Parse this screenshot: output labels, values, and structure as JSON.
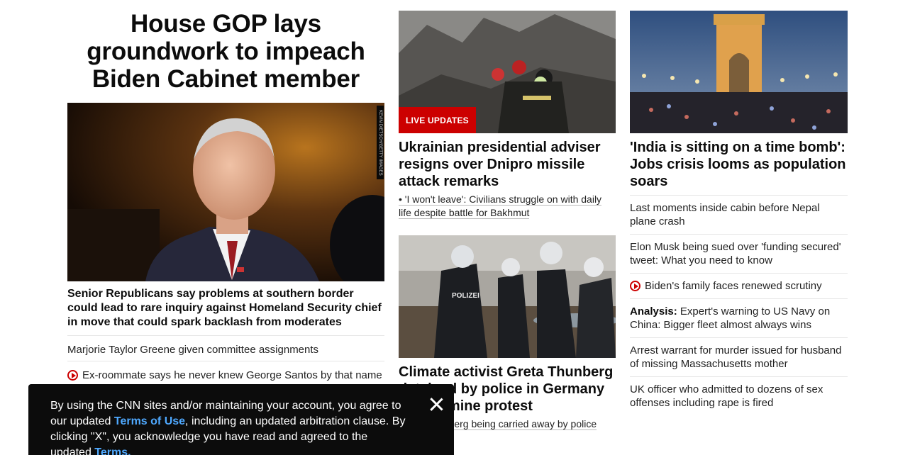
{
  "main_story": {
    "headline": "House GOP lays groundwork to impeach Biden Cabinet member",
    "image_credit": "KEVIN DIETSCH/GETTY IMAGES",
    "description": "Senior Republicans say problems at southern border could lead to rare inquiry against Homeland Security chief in move that could spark backlash from moderates",
    "related": [
      {
        "text": "Marjorie Taylor Greene given committee assignments",
        "video": false
      },
      {
        "text": "Ex-roommate says he never knew George Santos by that name",
        "video": true
      }
    ]
  },
  "middle_column": {
    "story1": {
      "badge": "LIVE UPDATES",
      "headline": "Ukrainian presidential adviser resigns over Dnipro missile attack remarks",
      "bullet": "• 'I won't leave': Civilians struggle on with daily life despite battle for Bakhmut"
    },
    "story2": {
      "headline": "Climate activist Greta Thunberg detained by police in Germany at coal mine protest",
      "subline": "Greta Thunberg being carried away by police"
    }
  },
  "right_column": {
    "headline": "'India is sitting on a time bomb': Jobs crisis looms as population soars",
    "links": [
      {
        "text": "Last moments inside cabin before Nepal plane crash"
      },
      {
        "text": "Elon Musk being sued over 'funding secured' tweet: What you need to know"
      },
      {
        "text": "Biden's family faces renewed scrutiny",
        "video": true
      },
      {
        "prefix": "Analysis:",
        "text": " Expert's warning to US Navy on China: Bigger fleet almost always wins"
      },
      {
        "text": "Arrest warrant for murder issued for husband of missing Massachusetts mother"
      },
      {
        "text": "UK officer who admitted to dozens of sex offenses including rape is fired"
      }
    ]
  },
  "consent_banner": {
    "text1": "By using the CNN sites and/or maintaining your account, you agree to our updated ",
    "link1": "Terms of Use",
    "text2": ", including an updated arbitration clause. By clicking \"X\", you acknowledge you have read and agreed to the updated ",
    "link2": "Terms."
  }
}
